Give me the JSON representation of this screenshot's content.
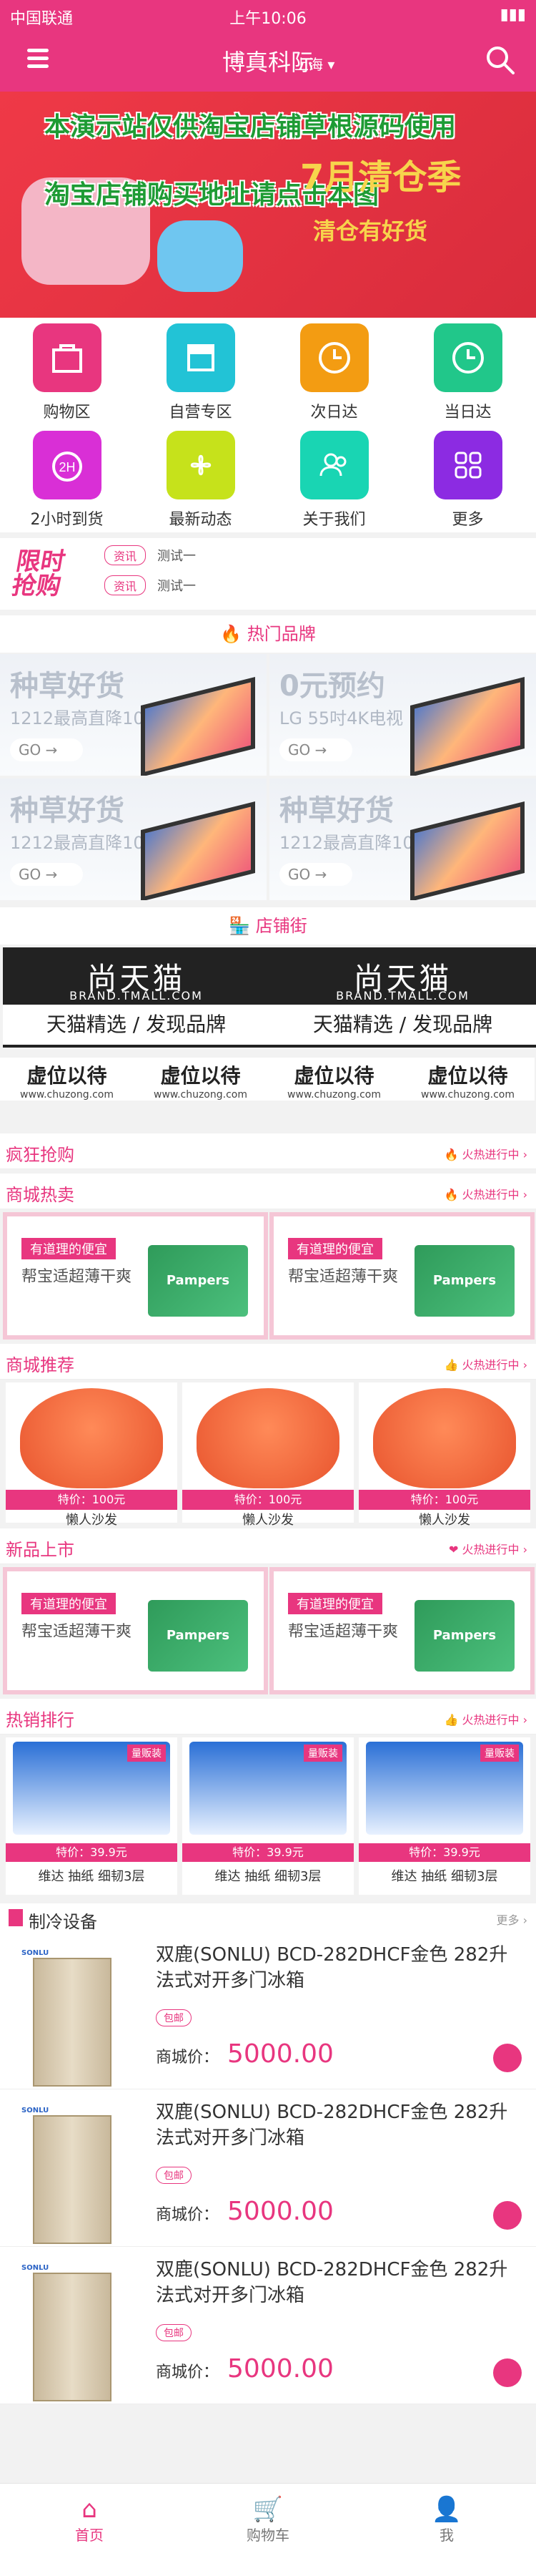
{
  "status": {
    "carrier": "中国联通",
    "time": "上午10:06"
  },
  "header": {
    "title": "博真科际",
    "city": "上海"
  },
  "banner": {
    "line1": "本演示站仅供淘宝店铺草根源码使用",
    "line2": "淘宝店铺购买地址请点击本图",
    "sale": "7月清仓季",
    "sub": "清仓有好货"
  },
  "grid": [
    {
      "label": "购物区",
      "color": "#e8367f"
    },
    {
      "label": "自营专区",
      "color": "#22c3d6"
    },
    {
      "label": "次日达",
      "color": "#f39c12"
    },
    {
      "label": "当日达",
      "color": "#21c78a"
    },
    {
      "label": "2小时到货",
      "color": "#d92fd6"
    },
    {
      "label": "最新动态",
      "color": "#c6e21b"
    },
    {
      "label": "关于我们",
      "color": "#19d5b3"
    },
    {
      "label": "更多",
      "color": "#8c2be2"
    }
  ],
  "promo": {
    "logo": "限时抢购",
    "tag": "资讯",
    "text": "测试一"
  },
  "hot_brand": {
    "title": "热门品牌",
    "items": [
      {
        "h": "种草好货",
        "s": "1212最高直降1000",
        "go": "GO"
      },
      {
        "h": "0元预约",
        "s": "LG 55吋4K电视",
        "go": "GO"
      },
      {
        "h": "种草好货",
        "s": "1212最高直降1000",
        "go": "GO"
      },
      {
        "h": "种草好货",
        "s": "1212最高直降1000",
        "go": "GO"
      }
    ]
  },
  "shop_street": {
    "title": "店铺街",
    "banner_big": "尚天猫",
    "banner_sm": "BRAND.TMALL.COM",
    "banner_bar": "天猫精选 / 发现品牌",
    "vw": {
      "a": "虚位以待",
      "b": "www.chuzong.com"
    }
  },
  "flash": {
    "title": "疯狂抢购",
    "hot": "火热进行中"
  },
  "mall_hot": {
    "title": "商城热卖",
    "hot": "火热进行中",
    "tag": "有道理的便宜",
    "desc": "帮宝适超薄干爽",
    "box": "Pampers"
  },
  "mall_rec": {
    "title": "商城推荐",
    "hot": "火热进行中",
    "price": "特价：100元",
    "name": "懒人沙发"
  },
  "new_goods": {
    "title": "新品上市",
    "hot": "火热进行中"
  },
  "rank": {
    "title": "热销排行",
    "hot": "火热进行中",
    "price": "特价：39.9元",
    "name": "维达 抽纸 细韧3层",
    "badge": "量贩装"
  },
  "cooling": {
    "title": "制冷设备",
    "more": "更多 ›",
    "brand": "SONLU",
    "name": "双鹿(SONLU) BCD-282DHCF金色 282升法式对开多门冰箱",
    "pill": "包邮",
    "price_label": "商城价：",
    "price": "5000.00"
  },
  "tabbar": {
    "home": "首页",
    "cart": "购物车",
    "me": "我"
  }
}
